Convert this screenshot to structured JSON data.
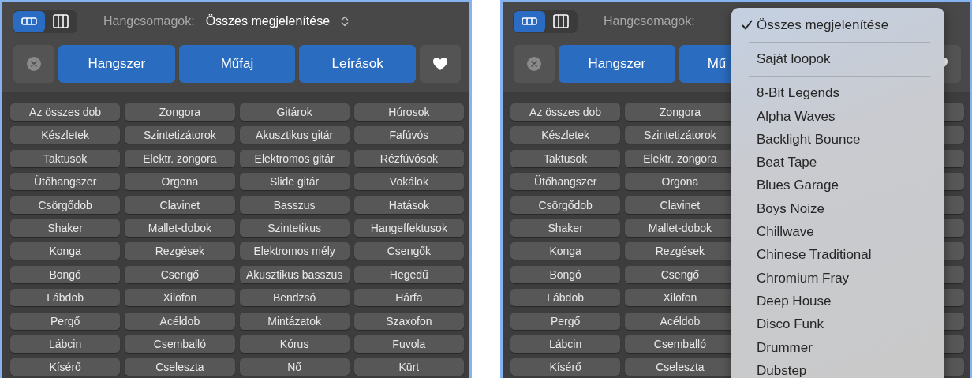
{
  "panels": [
    {
      "view_toggle": [
        {
          "kind": "rows",
          "selected": true
        },
        {
          "kind": "columns",
          "selected": false
        }
      ],
      "soundpack_label": "Hangcsomagok:",
      "soundpack_value": "Összes megjelenítése",
      "filter_buttons": [
        {
          "label": "Hangszer"
        },
        {
          "label": "Műfaj"
        },
        {
          "label": "Leírások"
        }
      ],
      "keywords": [
        [
          "Az összes dob",
          "Zongora",
          "Gitárok",
          "Húrosok"
        ],
        [
          "Készletek",
          "Szintetizátorok",
          "Akusztikus gitár",
          "Fafúvós"
        ],
        [
          "Taktusok",
          "Elektr. zongora",
          "Elektromos gitár",
          "Rézfúvósok"
        ],
        [
          "Ütőhangszer",
          "Orgona",
          "Slide gitár",
          "Vokálok"
        ],
        [
          "Csörgődob",
          "Clavinet",
          "Basszus",
          "Hatások"
        ],
        [
          "Shaker",
          "Mallet-dobok",
          "Szintetikus",
          "Hangeffektusok"
        ],
        [
          "Konga",
          "Rezgések",
          "Elektromos mély",
          "Csengők"
        ],
        [
          "Bongó",
          "Csengő",
          "Akusztikus basszus",
          "Hegedű"
        ],
        [
          "Lábdob",
          "Xilofon",
          "Bendzsó",
          "Hárfa"
        ],
        [
          "Pergő",
          "Acéldob",
          "Mintázatok",
          "Szaxofon"
        ],
        [
          "Lábcin",
          "Csemballó",
          "Kórus",
          "Fuvola"
        ],
        [
          "Kísérő",
          "Cseleszta",
          "Nő",
          "Kürt"
        ]
      ]
    },
    {
      "view_toggle": [
        {
          "kind": "rows",
          "selected": true
        },
        {
          "kind": "columns",
          "selected": false
        }
      ],
      "soundpack_label": "Hangcsomagok:",
      "filter_buttons": [
        {
          "label": "Hangszer"
        },
        {
          "label": "Mű"
        }
      ],
      "keywords": [
        [
          "Az összes dob",
          "Zongora"
        ],
        [
          "Készletek",
          "Szintetizátorok"
        ],
        [
          "Taktusok",
          "Elektr. zongora"
        ],
        [
          "Ütőhangszer",
          "Orgona"
        ],
        [
          "Csörgődob",
          "Clavinet"
        ],
        [
          "Shaker",
          "Mallet-dobok"
        ],
        [
          "Konga",
          "Rezgések"
        ],
        [
          "Bongó",
          "Csengő"
        ],
        [
          "Lábdob",
          "Xilofon"
        ],
        [
          "Pergő",
          "Acéldob"
        ],
        [
          "Lábcin",
          "Csemballó"
        ],
        [
          "Kísérő",
          "Cseleszta"
        ]
      ],
      "menu": [
        {
          "kind": "item",
          "label": "Összes megjelenítése",
          "checked": true
        },
        {
          "kind": "separator"
        },
        {
          "kind": "item",
          "label": "Saját loopok",
          "checked": false
        },
        {
          "kind": "separator"
        },
        {
          "kind": "item",
          "label": "8-Bit Legends",
          "checked": false
        },
        {
          "kind": "item",
          "label": "Alpha Waves",
          "checked": false
        },
        {
          "kind": "item",
          "label": "Backlight Bounce",
          "checked": false
        },
        {
          "kind": "item",
          "label": "Beat Tape",
          "checked": false
        },
        {
          "kind": "item",
          "label": "Blues Garage",
          "checked": false
        },
        {
          "kind": "item",
          "label": "Boys Noize",
          "checked": false
        },
        {
          "kind": "item",
          "label": "Chillwave",
          "checked": false
        },
        {
          "kind": "item",
          "label": "Chinese Traditional",
          "checked": false
        },
        {
          "kind": "item",
          "label": "Chromium Fray",
          "checked": false
        },
        {
          "kind": "item",
          "label": "Deep House",
          "checked": false
        },
        {
          "kind": "item",
          "label": "Disco Funk",
          "checked": false
        },
        {
          "kind": "item",
          "label": "Drummer",
          "checked": false
        },
        {
          "kind": "item",
          "label": "Dubstep",
          "checked": false
        }
      ]
    }
  ]
}
